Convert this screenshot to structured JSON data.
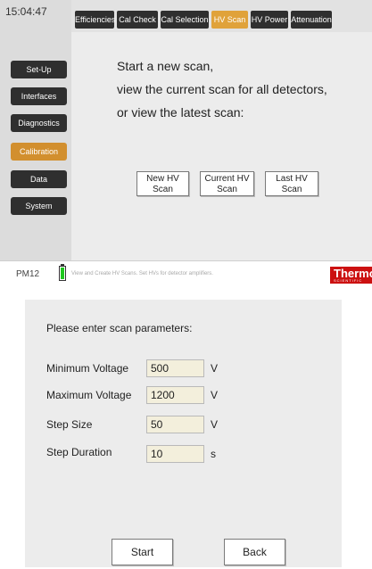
{
  "header": {
    "time": "15:04:47",
    "tabs": [
      {
        "label": "Efficiencies",
        "active": false
      },
      {
        "label": "Cal Check",
        "active": false
      },
      {
        "label": "Cal Selection",
        "active": false
      },
      {
        "label": "HV Scan",
        "active": true
      },
      {
        "label": "HV Power",
        "active": false
      },
      {
        "label": "Attenuation",
        "active": false
      }
    ]
  },
  "sidebar": {
    "items": [
      {
        "label": "Set-Up",
        "active": false
      },
      {
        "label": "Interfaces",
        "active": false
      },
      {
        "label": "Diagnostics",
        "active": false
      },
      {
        "label": "Calibration",
        "active": true
      },
      {
        "label": "Data",
        "active": false
      },
      {
        "label": "System",
        "active": false
      }
    ]
  },
  "hv_scan": {
    "intro_lines": [
      "Start a new scan,",
      "view the current  scan for all detectors,",
      "or view the latest scan:"
    ],
    "buttons": [
      {
        "line1": "New HV",
        "line2": "Scan"
      },
      {
        "line1": "Current HV",
        "line2": "Scan"
      },
      {
        "line1": "Last HV",
        "line2": "Scan"
      }
    ]
  },
  "status_bar": {
    "device": "PM12",
    "message": "View and Create HV Scans.  Set HVs for detector amplifiers.",
    "battery_level": 1.0,
    "logo_main": "Thermo",
    "logo_sub": "SCIENTIFIC"
  },
  "scan_params": {
    "prompt": "Please enter scan parameters:",
    "fields": [
      {
        "label": "Minimum Voltage",
        "value": "500",
        "unit": "V"
      },
      {
        "label": "Maximum Voltage",
        "value": "1200",
        "unit": "V"
      },
      {
        "label": "Step Size",
        "value": "50",
        "unit": "V"
      },
      {
        "label": "Step Duration",
        "value": "10",
        "unit": "s"
      }
    ],
    "start_label": "Start",
    "back_label": "Back"
  },
  "colors": {
    "active_accent": "#e0a23a",
    "button_dark": "#2f2f2f",
    "input_bg": "#f3efdc",
    "battery_green": "#1ec81e",
    "logo_red": "#cc1111"
  }
}
